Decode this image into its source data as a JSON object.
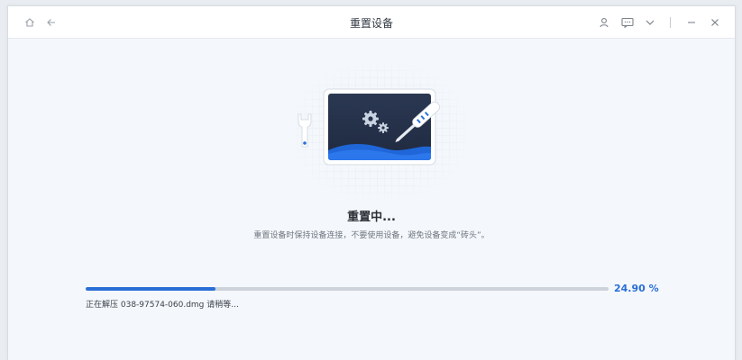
{
  "window": {
    "title": "重置设备"
  },
  "titlebar_icons": [
    "home-icon",
    "back-arrow-icon",
    "user-icon",
    "feedback-icon",
    "chevron-down-icon",
    "minimize-icon",
    "close-icon"
  ],
  "status": {
    "heading": "重置中...",
    "description": "重置设备时保持设备连接，不要使用设备，避免设备变成“砖头”。"
  },
  "progress": {
    "percent": 24.9,
    "percent_label": "24.90 %",
    "file_status": "正在解压 038-97574-060.dmg 请稍等..."
  },
  "colors": {
    "accent": "#2a6fd6",
    "screen_dark": "#26324a",
    "wave": "#1f66d8"
  }
}
